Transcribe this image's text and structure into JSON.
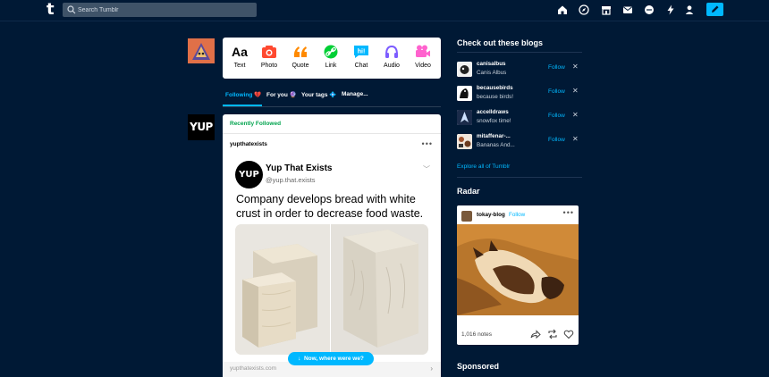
{
  "header": {
    "logo": "t",
    "search_placeholder": "Search Tumblr",
    "icons": [
      "home-icon",
      "explore-icon",
      "shop-icon",
      "inbox-icon",
      "messages-icon",
      "activity-icon",
      "account-icon",
      "compose-icon"
    ]
  },
  "composer": {
    "buttons": [
      {
        "label": "Text",
        "icon": "text-icon",
        "color": "#000000"
      },
      {
        "label": "Photo",
        "icon": "photo-icon",
        "color": "#ff4930"
      },
      {
        "label": "Quote",
        "icon": "quote-icon",
        "color": "#ff8a00"
      },
      {
        "label": "Link",
        "icon": "link-icon",
        "color": "#00cf35"
      },
      {
        "label": "Chat",
        "icon": "chat-icon",
        "color": "#00b8ff"
      },
      {
        "label": "Audio",
        "icon": "audio-icon",
        "color": "#7c5cff"
      },
      {
        "label": "Video",
        "icon": "video-icon",
        "color": "#ff62ce"
      }
    ]
  },
  "tabs": [
    {
      "label": "Following 💔"
    },
    {
      "label": "For you 🔮"
    },
    {
      "label": "Your tags 💠"
    },
    {
      "label": "Manage..."
    }
  ],
  "post": {
    "badge": "Recently Followed",
    "author": "yupthatexists",
    "avatar_text": "YUP",
    "tweet": {
      "name": "Yup That Exists",
      "handle": "@yup.that.exists",
      "text": "Company develops bread with white crust in order to decrease food waste."
    },
    "footer_url": "yupthatexists.com",
    "jump_button": "Now, where were we?"
  },
  "sidebar": {
    "blogs_title": "Check out these blogs",
    "follow_label": "Follow",
    "blogs": [
      {
        "name": "canisalbus",
        "sub": "Canis Albus"
      },
      {
        "name": "becausebirds",
        "sub": "because birds!"
      },
      {
        "name": "accelldraws",
        "sub": "snowfox time!"
      },
      {
        "name": "mitaffenar-...",
        "sub": "Bananas And..."
      }
    ],
    "explore": "Explore all of Tumblr",
    "radar_title": "Radar",
    "radar": {
      "name": "tokay-blog",
      "follow": "Follow",
      "notes": "1,016 notes"
    },
    "sponsored_title": "Sponsored"
  },
  "colors": {
    "background": "#001935",
    "accent": "#00b8ff",
    "green": "#00a34d"
  }
}
